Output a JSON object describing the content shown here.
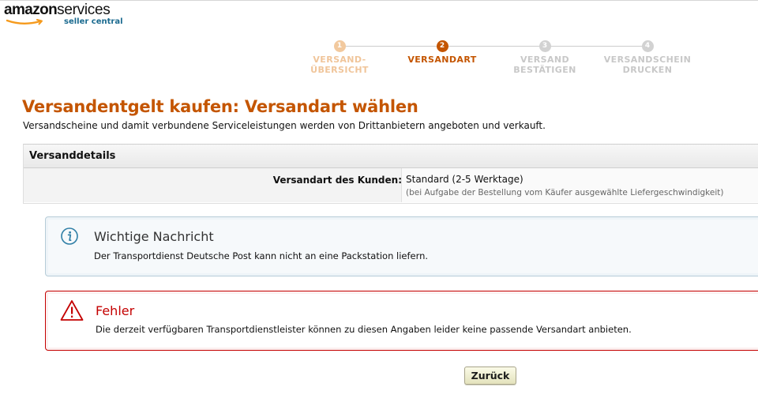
{
  "brand": {
    "name": "amazon",
    "product": "services",
    "sub": "seller central"
  },
  "stepper": {
    "steps": [
      {
        "number": "1",
        "line1": "VERSAND-",
        "line2": "ÜBERSICHT",
        "state": "done"
      },
      {
        "number": "2",
        "line1": "VERSANDART",
        "line2": "",
        "state": "active"
      },
      {
        "number": "3",
        "line1": "VERSAND",
        "line2": "BESTÄTIGEN",
        "state": "todo"
      },
      {
        "number": "4",
        "line1": "VERSANDSCHEIN",
        "line2": "DRUCKEN",
        "state": "todo"
      }
    ]
  },
  "page": {
    "title": "Versandentgelt kaufen: Versandart wählen",
    "subtitle": "Versandscheine und damit verbundene Serviceleistungen werden von Drittanbietern angeboten und verkauft."
  },
  "details": {
    "header": "Versanddetails",
    "label": "Versandart des Kunden:",
    "value": "Standard (2-5 Werktage)",
    "note": "(bei Aufgabe der Bestellung vom Käufer ausgewählte Liefergeschwindigkeit)"
  },
  "info_alert": {
    "title": "Wichtige Nachricht",
    "text": "Der Transportdienst Deutsche Post kann nicht an eine Packstation liefern.",
    "icon": "info-icon"
  },
  "error_alert": {
    "title": "Fehler",
    "text": "Die derzeit verfügbaren Transportdienstleister können zu diesen Angaben leider keine passende Versandart anbieten.",
    "icon": "warning-icon"
  },
  "actions": {
    "back_label": "Zurück"
  },
  "colors": {
    "accent": "#c45500",
    "error": "#c40000",
    "info": "#2f7fa6"
  }
}
